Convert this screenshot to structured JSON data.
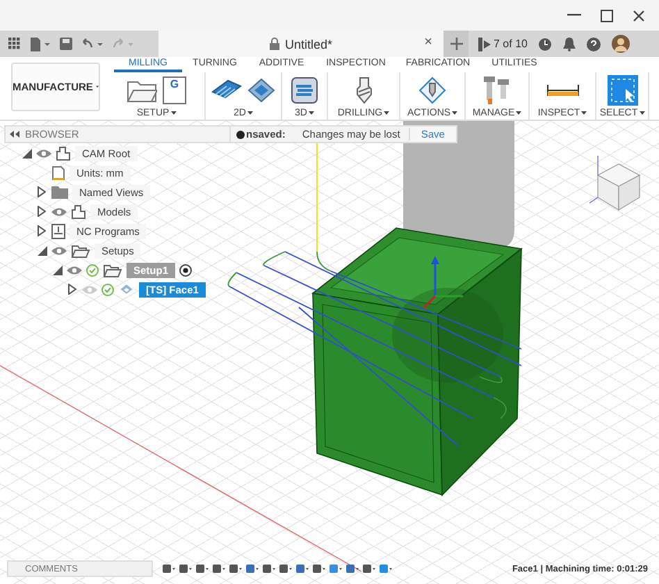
{
  "title_bar": {
    "document": "Untitled*",
    "close": "×",
    "job_status": "7 of 10"
  },
  "workspace": {
    "label": "MANUFACTURE"
  },
  "tabs": [
    {
      "label": "MILLING",
      "selected": true
    },
    {
      "label": "TURNING",
      "selected": false
    },
    {
      "label": "ADDITIVE",
      "selected": false
    },
    {
      "label": "INSPECTION",
      "selected": false
    },
    {
      "label": "FABRICATION",
      "selected": false
    },
    {
      "label": "UTILITIES",
      "selected": false
    }
  ],
  "groups": [
    {
      "kind": "setup",
      "label": "SETUP",
      "badge": "G"
    },
    {
      "kind": "planar",
      "label": "2D"
    },
    {
      "kind": "surface",
      "label": "3D"
    },
    {
      "kind": "drilling",
      "label": "DRILLING"
    },
    {
      "kind": "actions",
      "label": "ACTIONS"
    },
    {
      "kind": "manage",
      "label": "MANAGE"
    },
    {
      "kind": "inspect",
      "label": "INSPECT"
    },
    {
      "kind": "select",
      "label": "SELECT"
    }
  ],
  "browser": {
    "title": "BROWSER",
    "tree": [
      {
        "kind": "root",
        "label": "CAM Root",
        "expanded": true,
        "visible": true,
        "children": [
          {
            "kind": "units",
            "label": "Units: mm"
          },
          {
            "kind": "views",
            "label": "Named Views",
            "expanded": false
          },
          {
            "kind": "models",
            "label": "Models",
            "expanded": false,
            "visible": true
          },
          {
            "kind": "programs",
            "label": "NC Programs",
            "expanded": false
          },
          {
            "kind": "setups",
            "label": "Setups",
            "expanded": true,
            "visible": true,
            "children": [
              {
                "kind": "setup",
                "label": "Setup1",
                "expanded": true,
                "visible": true,
                "selected": false,
                "children": [
                  {
                    "kind": "operation",
                    "label": "[TS] Face1",
                    "expanded": false,
                    "visible": false,
                    "selected": true
                  }
                ]
              }
            ]
          }
        ]
      }
    ]
  },
  "unsaved": {
    "label": "nsaved:",
    "message": "Changes may be lost",
    "action": "Save"
  },
  "status_bar": {
    "comments": "COMMENTS",
    "info": "Face1 | Machining time: 0:01:29"
  }
}
